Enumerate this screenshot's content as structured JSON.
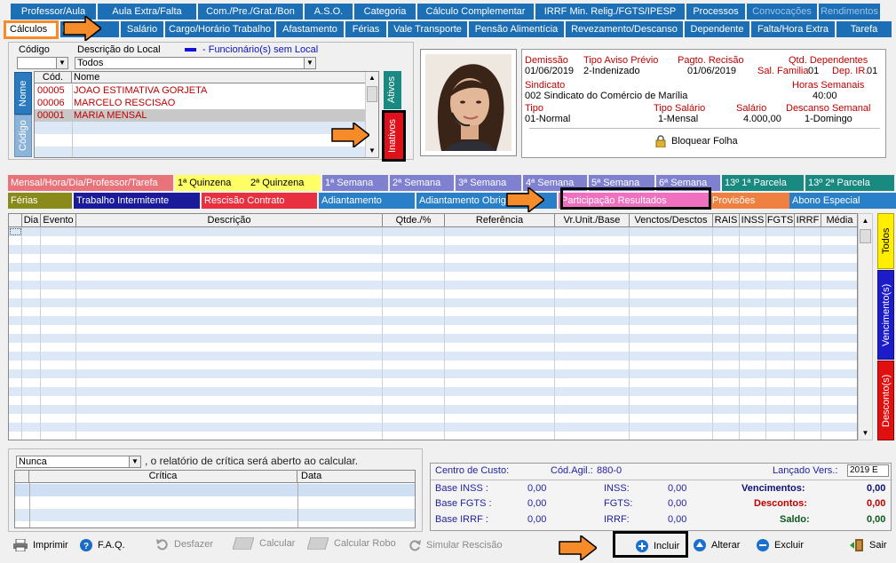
{
  "top_tabs": [
    {
      "label": "Professor/Aula"
    },
    {
      "label": "Aula Extra/Falta"
    },
    {
      "label": "Com./Pre./Grat./Bon"
    },
    {
      "label": "A.S.O."
    },
    {
      "label": "Categoria"
    },
    {
      "label": "Cálculo Complementar"
    },
    {
      "label": "IRRF Min. Relig./FGTS/IPESP"
    },
    {
      "label": "Processos"
    },
    {
      "label": "Convocações"
    },
    {
      "label": "Rendimentos"
    }
  ],
  "sub_tabs": [
    {
      "label": "Cálculos"
    },
    {
      "label": "F"
    },
    {
      "label": "Salário"
    },
    {
      "label": "Cargo/Horário Trabalho"
    },
    {
      "label": "Afastamento"
    },
    {
      "label": "Férias"
    },
    {
      "label": "Vale Transporte"
    },
    {
      "label": "Pensão Alimentícia"
    },
    {
      "label": "Revezamento/Descanso"
    },
    {
      "label": "Dependente"
    },
    {
      "label": "Falta/Hora Extra"
    },
    {
      "label": "Tarefa"
    }
  ],
  "filter": {
    "codigo_label": "Código",
    "descricao_label": "Descrição do Local",
    "legend": "- Funcionário(s) sem Local",
    "descricao_value": "Todos"
  },
  "employee_list": {
    "col_cod": "Cód.",
    "col_nome": "Nome",
    "side_nome": "Nome",
    "side_codigo": "Código",
    "ativos": "Ativos",
    "inativos": "Inativos",
    "rows": [
      {
        "cod": "00005",
        "nome": "JOAO ESTIMATIVA GORJETA"
      },
      {
        "cod": "00006",
        "nome": "MARCELO RESCISAO"
      },
      {
        "cod": "00001",
        "nome": "MARIA MENSAL"
      }
    ]
  },
  "info": {
    "demissao_l": "Demissão",
    "demissao_v": "01/06/2019",
    "tipo_aviso_l": "Tipo Aviso Prévio",
    "tipo_aviso_v": "2-Indenizado",
    "pagto_l": "Pagto. Recisão",
    "pagto_v": "01/06/2019",
    "qtd_dep_l": "Qtd. Dependentes",
    "sal_fam_l": "Sal. Familia",
    "sal_fam_v": "01",
    "dep_ir_l": "Dep. IR.",
    "dep_ir_v": "01",
    "sindicato_l": "Sindicato",
    "sindicato_v": "002  Sindicato do Comércio de Marília",
    "horas_l": "Horas Semanais",
    "horas_v": "40:00",
    "tipo_l": "Tipo",
    "tipo_v": "01-Normal",
    "tipo_sal_l": "Tipo Salário",
    "tipo_sal_v": "1-Mensal",
    "salario_l": "Salário",
    "salario_v": "4.000,00",
    "descanso_l": "Descanso Semanal",
    "descanso_v": "1-Domingo",
    "bloquear": "Bloquear Folha"
  },
  "calc_tabs_row1": [
    {
      "label": "Mensal/Hora/Dia/Professor/Tarefa",
      "bg": "#e8737a",
      "fg": "#ffffff"
    },
    {
      "label": "1ª Quinzena",
      "bg": "#ffff66",
      "fg": "#000000"
    },
    {
      "label": "2ª Quinzena",
      "bg": "#ffff66",
      "fg": "#000000"
    },
    {
      "label": "1ª Semana",
      "bg": "#7f80d0",
      "fg": "#ffffff"
    },
    {
      "label": "2ª Semana",
      "bg": "#7f80d0",
      "fg": "#ffffff"
    },
    {
      "label": "3ª Semana",
      "bg": "#7f80d0",
      "fg": "#ffffff"
    },
    {
      "label": "4ª Semana",
      "bg": "#7f80d0",
      "fg": "#ffffff"
    },
    {
      "label": "5ª Semana",
      "bg": "#7f80d0",
      "fg": "#ffffff"
    },
    {
      "label": "6ª Semana",
      "bg": "#7f80d0",
      "fg": "#ffffff"
    },
    {
      "label": "13º  1ª Parcela",
      "bg": "#1a8a80",
      "fg": "#ffffff"
    },
    {
      "label": "13º  2ª Parcela",
      "bg": "#1a8a80",
      "fg": "#ffffff"
    }
  ],
  "calc_tabs_row2": [
    {
      "label": "Férias",
      "bg": "#8a8a1a",
      "fg": "#ffffff"
    },
    {
      "label": "Trabalho Intermitente",
      "bg": "#1a1a9a",
      "fg": "#ffffff"
    },
    {
      "label": "Rescisão Contrato",
      "bg": "#e83040",
      "fg": "#ffffff"
    },
    {
      "label": "Adiantamento",
      "bg": "#2a80c8",
      "fg": "#ffffff"
    },
    {
      "label": "Adiantamento Obriga",
      "bg": "#2a80c8",
      "fg": "#ffffff"
    },
    {
      "label": "Participação Resultados",
      "bg": "#f070c0",
      "fg": "#ffffff"
    },
    {
      "label": "Provisões",
      "bg": "#f08040",
      "fg": "#ffffff"
    },
    {
      "label": "Abono Especial",
      "bg": "#2a80c8",
      "fg": "#ffffff"
    }
  ],
  "grid_headers": [
    "Dia",
    "Evento",
    "Descrição",
    "Qtde./%",
    "Referência",
    "Vr.Unit./Base",
    "Venctos/Desctos",
    "RAIS",
    "INSS",
    "FGTS",
    "IRRF",
    "Média"
  ],
  "side_tabs": {
    "todos": "Todos",
    "vencimentos": "Vencimento(s)",
    "descontos": "Desconto(s)"
  },
  "critica": {
    "select": "Nunca",
    "text": ", o relatório de crítica será aberto ao calcular.",
    "col1": "Crítica",
    "col2": "Data"
  },
  "totals": {
    "centro": "Centro de Custo:",
    "cod_agil_l": "Cód.Agil.:",
    "cod_agil_v": "880-0",
    "lancado_l": "Lançado Vers.:",
    "lancado_v": "2019 E",
    "base_inss_l": "Base  INSS :",
    "base_inss_v": "0,00",
    "inss_l": "INSS:",
    "inss_v": "0,00",
    "venc_l": "Vencimentos:",
    "venc_v": "0,00",
    "base_fgts_l": "Base FGTS :",
    "base_fgts_v": "0,00",
    "fgts_l": "FGTS:",
    "fgts_v": "0,00",
    "desc_l": "Descontos:",
    "desc_v": "0,00",
    "base_irrf_l": "Base  IRRF :",
    "base_irrf_v": "0,00",
    "irrf_l": "IRRF:",
    "irrf_v": "0,00",
    "saldo_l": "Saldo:",
    "saldo_v": "0,00"
  },
  "buttons": {
    "imprimir": "Imprimir",
    "faq": "F.A.Q.",
    "desfazer": "Desfazer",
    "calcular": "Calcular",
    "calcular_robo": "Calcular Robo",
    "simular": "Simular Rescisão",
    "incluir": "Incluir",
    "alterar": "Alterar",
    "excluir": "Excluir",
    "sair": "Sair"
  },
  "colors": {
    "tab_blue": "#1c6fb5",
    "arrow": "#f68b2a",
    "highlight_red": "#e0101a"
  }
}
